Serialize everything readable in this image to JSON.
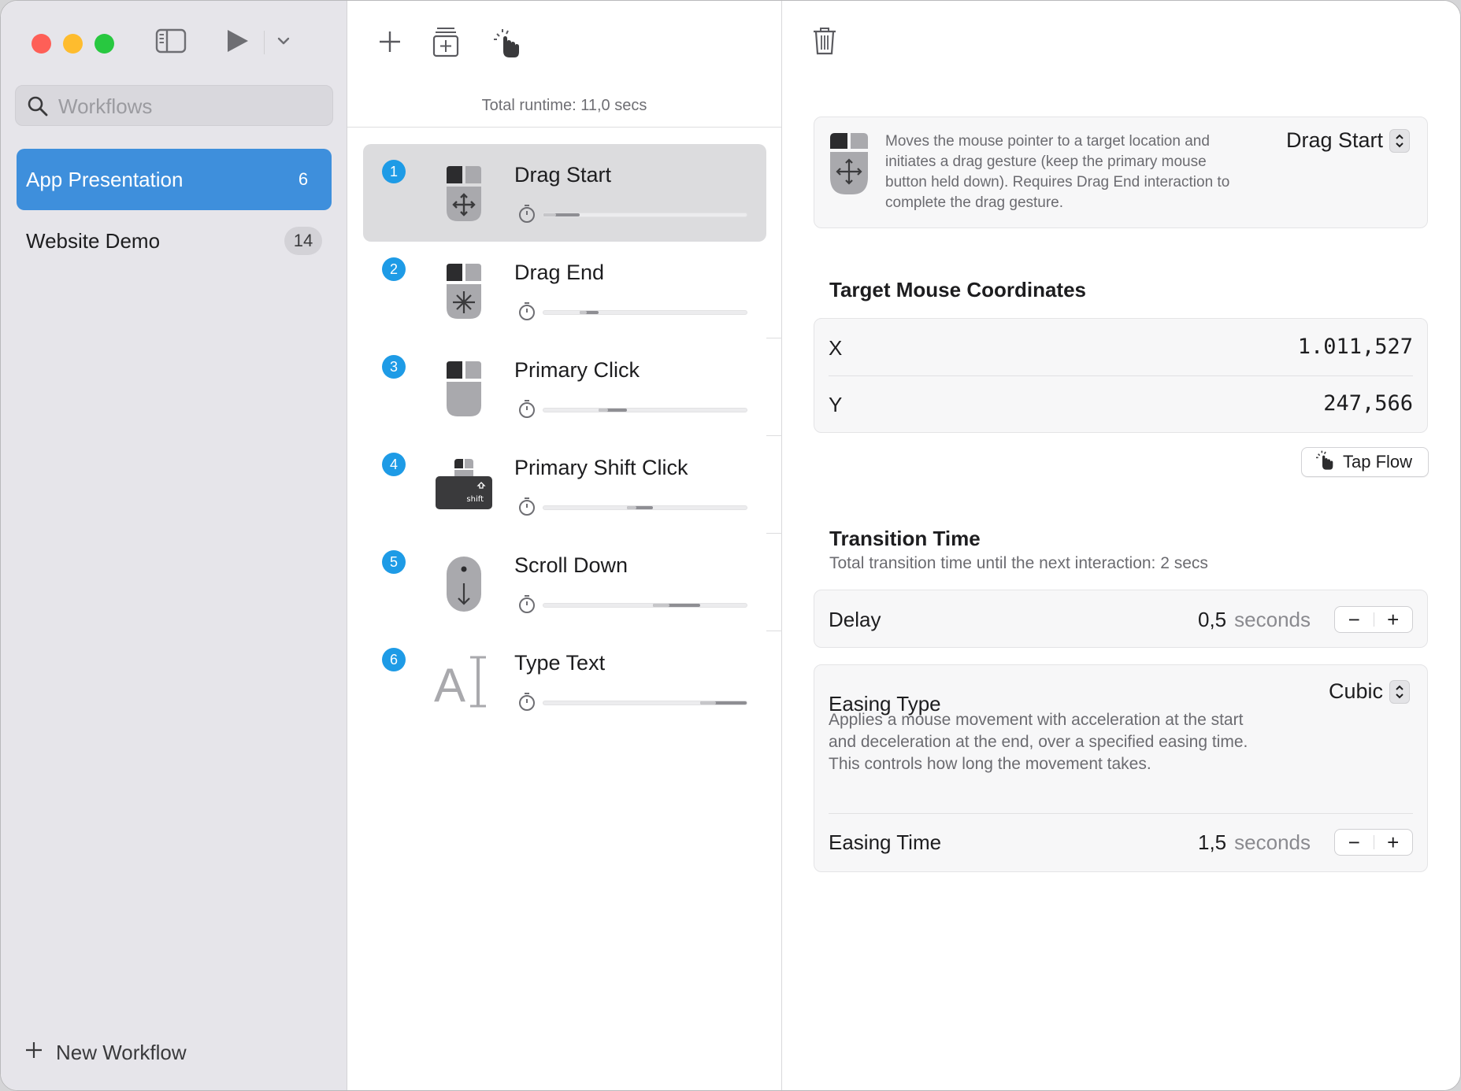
{
  "sidebar": {
    "search_placeholder": "Workflows",
    "workflows": [
      {
        "name": "App Presentation",
        "count": "6",
        "active": true
      },
      {
        "name": "Website Demo",
        "count": "14",
        "active": false
      }
    ],
    "new_workflow_label": "New Workflow"
  },
  "steps_panel": {
    "runtime": "Total runtime: 11,0 secs",
    "steps": [
      {
        "number": "1",
        "title": "Drag Start",
        "icon": "mouse-drag-icon",
        "bar_start": 0.0,
        "bar_end": 0.18
      },
      {
        "number": "2",
        "title": "Drag End",
        "icon": "mouse-drag-end-icon",
        "bar_start": 0.18,
        "bar_end": 0.27
      },
      {
        "number": "3",
        "title": "Primary Click",
        "icon": "mouse-click-icon",
        "bar_start": 0.27,
        "bar_end": 0.41
      },
      {
        "number": "4",
        "title": "Primary Shift Click",
        "icon": "shift-click-icon",
        "bar_start": 0.41,
        "bar_end": 0.54
      },
      {
        "number": "5",
        "title": "Scroll Down",
        "icon": "scroll-mouse-icon",
        "bar_start": 0.54,
        "bar_end": 0.77
      },
      {
        "number": "6",
        "title": "Type Text",
        "icon": "text-cursor-icon",
        "bar_start": 0.77,
        "bar_end": 1.0
      }
    ]
  },
  "detail": {
    "action_description": "Moves the mouse pointer to a target location and initiates a drag gesture (keep the primary mouse button held down). Requires Drag End interaction to complete the drag gesture.",
    "action_type": "Drag Start",
    "coords_title": "Target Mouse Coordinates",
    "x_label": "X",
    "x_value": "1.011,527",
    "y_label": "Y",
    "y_value": "247,566",
    "tap_flow_label": "Tap Flow",
    "transition_title": "Transition Time",
    "transition_sub": "Total transition time until the next interaction: 2 secs",
    "delay_label": "Delay",
    "delay_value": "0,5",
    "delay_unit": "seconds",
    "easing_type_label": "Easing Type",
    "easing_type_value": "Cubic",
    "easing_desc": "Applies a mouse movement with acceleration at the start and deceleration at the end, over a specified easing time. This controls how long the movement takes.",
    "easing_time_label": "Easing Time",
    "easing_time_value": "1,5",
    "easing_time_unit": "seconds"
  },
  "colors": {
    "accent": "#3e8fdc",
    "step_badge": "#1e9be6",
    "sidebar_bg": "#e6e5ea"
  }
}
